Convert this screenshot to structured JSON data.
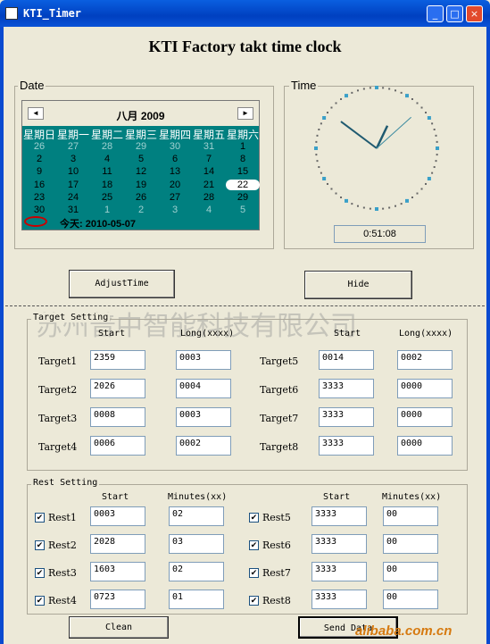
{
  "window": {
    "title": "KTI_Timer",
    "buttons": [
      "_",
      "□",
      "×"
    ]
  },
  "heading": "KTI Factory takt time clock",
  "date_group": {
    "label": "Date"
  },
  "time_group": {
    "label": "Time",
    "value": "0:51:08"
  },
  "calendar": {
    "month": "八月 2009",
    "prev": "◄",
    "next": "►",
    "weekdays": [
      "星期日",
      "星期一",
      "星期二",
      "星期三",
      "星期四",
      "星期五",
      "星期六"
    ],
    "weeks": [
      [
        "26",
        "27",
        "28",
        "29",
        "30",
        "31",
        "1"
      ],
      [
        "2",
        "3",
        "4",
        "5",
        "6",
        "7",
        "8"
      ],
      [
        "9",
        "10",
        "11",
        "12",
        "13",
        "14",
        "15"
      ],
      [
        "16",
        "17",
        "18",
        "19",
        "20",
        "21",
        "22"
      ],
      [
        "23",
        "24",
        "25",
        "26",
        "27",
        "28",
        "29"
      ],
      [
        "30",
        "31",
        "1",
        "2",
        "3",
        "4",
        "5"
      ]
    ],
    "selected": "22",
    "today": "今天: 2010-05-07"
  },
  "buttons": {
    "adjust": "AdjustTime",
    "hide": "Hide",
    "clean": "Clean",
    "send": "Send Data"
  },
  "watermark": "苏州普中智能科技有限公司",
  "corner_watermark": "alibaba.com.cn",
  "target_setting": {
    "label": "Target Setting",
    "col_start": "Start",
    "col_long": "Long(xxxx)",
    "rows": [
      {
        "name": "Target1",
        "start": "2359",
        "long": "0003"
      },
      {
        "name": "Target2",
        "start": "2026",
        "long": "0004"
      },
      {
        "name": "Target3",
        "start": "0008",
        "long": "0003"
      },
      {
        "name": "Target4",
        "start": "0006",
        "long": "0002"
      },
      {
        "name": "Target5",
        "start": "0014",
        "long": "0002"
      },
      {
        "name": "Target6",
        "start": "3333",
        "long": "0000"
      },
      {
        "name": "Target7",
        "start": "3333",
        "long": "0000"
      },
      {
        "name": "Target8",
        "start": "3333",
        "long": "0000"
      }
    ]
  },
  "rest_setting": {
    "label": "Rest Setting",
    "col_start": "Start",
    "col_minutes": "Minutes(xx)",
    "rows": [
      {
        "name": "Rest1",
        "checked": true,
        "start": "0003",
        "minutes": "02"
      },
      {
        "name": "Rest2",
        "checked": true,
        "start": "2028",
        "minutes": "03"
      },
      {
        "name": "Rest3",
        "checked": true,
        "start": "1603",
        "minutes": "02"
      },
      {
        "name": "Rest4",
        "checked": true,
        "start": "0723",
        "minutes": "01"
      },
      {
        "name": "Rest5",
        "checked": true,
        "start": "3333",
        "minutes": "00"
      },
      {
        "name": "Rest6",
        "checked": true,
        "start": "3333",
        "minutes": "00"
      },
      {
        "name": "Rest7",
        "checked": true,
        "start": "3333",
        "minutes": "00"
      },
      {
        "name": "Rest8",
        "checked": true,
        "start": "3333",
        "minutes": "00"
      }
    ]
  },
  "colors": {
    "calendar_bg": "#008080",
    "title_bar": "#0a52d6",
    "clock_marks": "#3aa0c8"
  }
}
